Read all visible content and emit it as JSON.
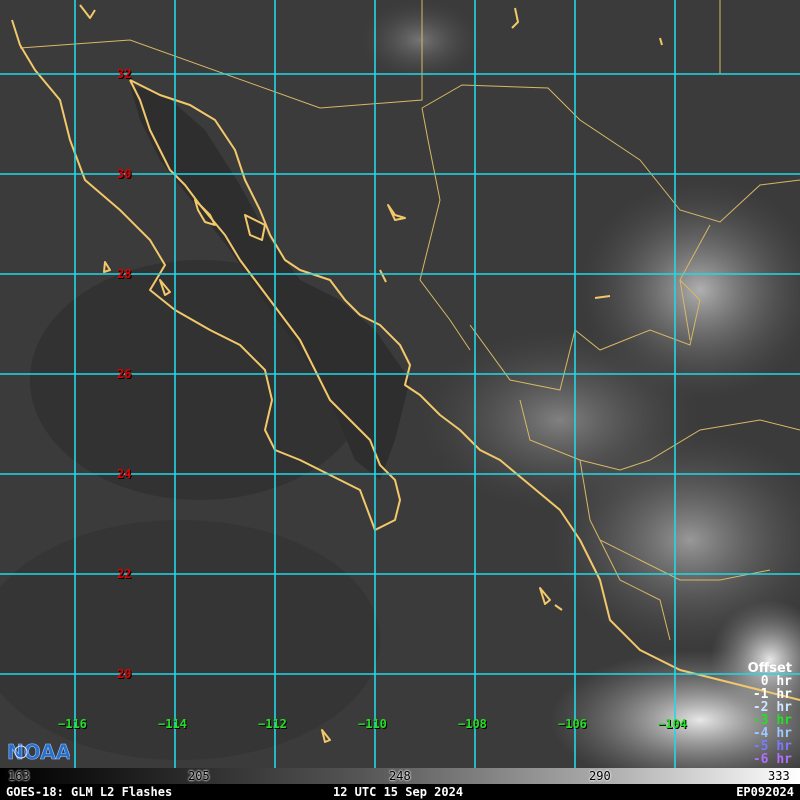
{
  "map": {
    "background": "#3a3a3a",
    "grid_color": "#22d8e8",
    "coast_color": "#f2c86a",
    "border_color": "#d8b866",
    "latitudes": [
      "32",
      "30",
      "28",
      "26",
      "24",
      "22",
      "20"
    ],
    "longitudes": [
      "−116",
      "−114",
      "−112",
      "−110",
      "−108",
      "−106",
      "−104"
    ]
  },
  "logo": {
    "text": "NOAA",
    "icon": "noaa-logo-icon"
  },
  "offset_legend": {
    "title": "Offset",
    "entries": [
      {
        "label": "0 hr",
        "color": "#ffffff"
      },
      {
        "label": "-1 hr",
        "color": "#ffffff"
      },
      {
        "label": "-2 hr",
        "color": "#cfe8ff"
      },
      {
        "label": "-3 hr",
        "color": "#22e022"
      },
      {
        "label": "-4 hr",
        "color": "#9ec8ff"
      },
      {
        "label": "-5 hr",
        "color": "#7a7aff"
      },
      {
        "label": "-6 hr",
        "color": "#b070ff"
      }
    ]
  },
  "colorbar": {
    "ticks": [
      "163",
      "205",
      "248",
      "290",
      "333"
    ]
  },
  "footer": {
    "left": "GOES-18: GLM L2 Flashes",
    "center": "12 UTC 15 Sep 2024",
    "right": "EP092024"
  }
}
